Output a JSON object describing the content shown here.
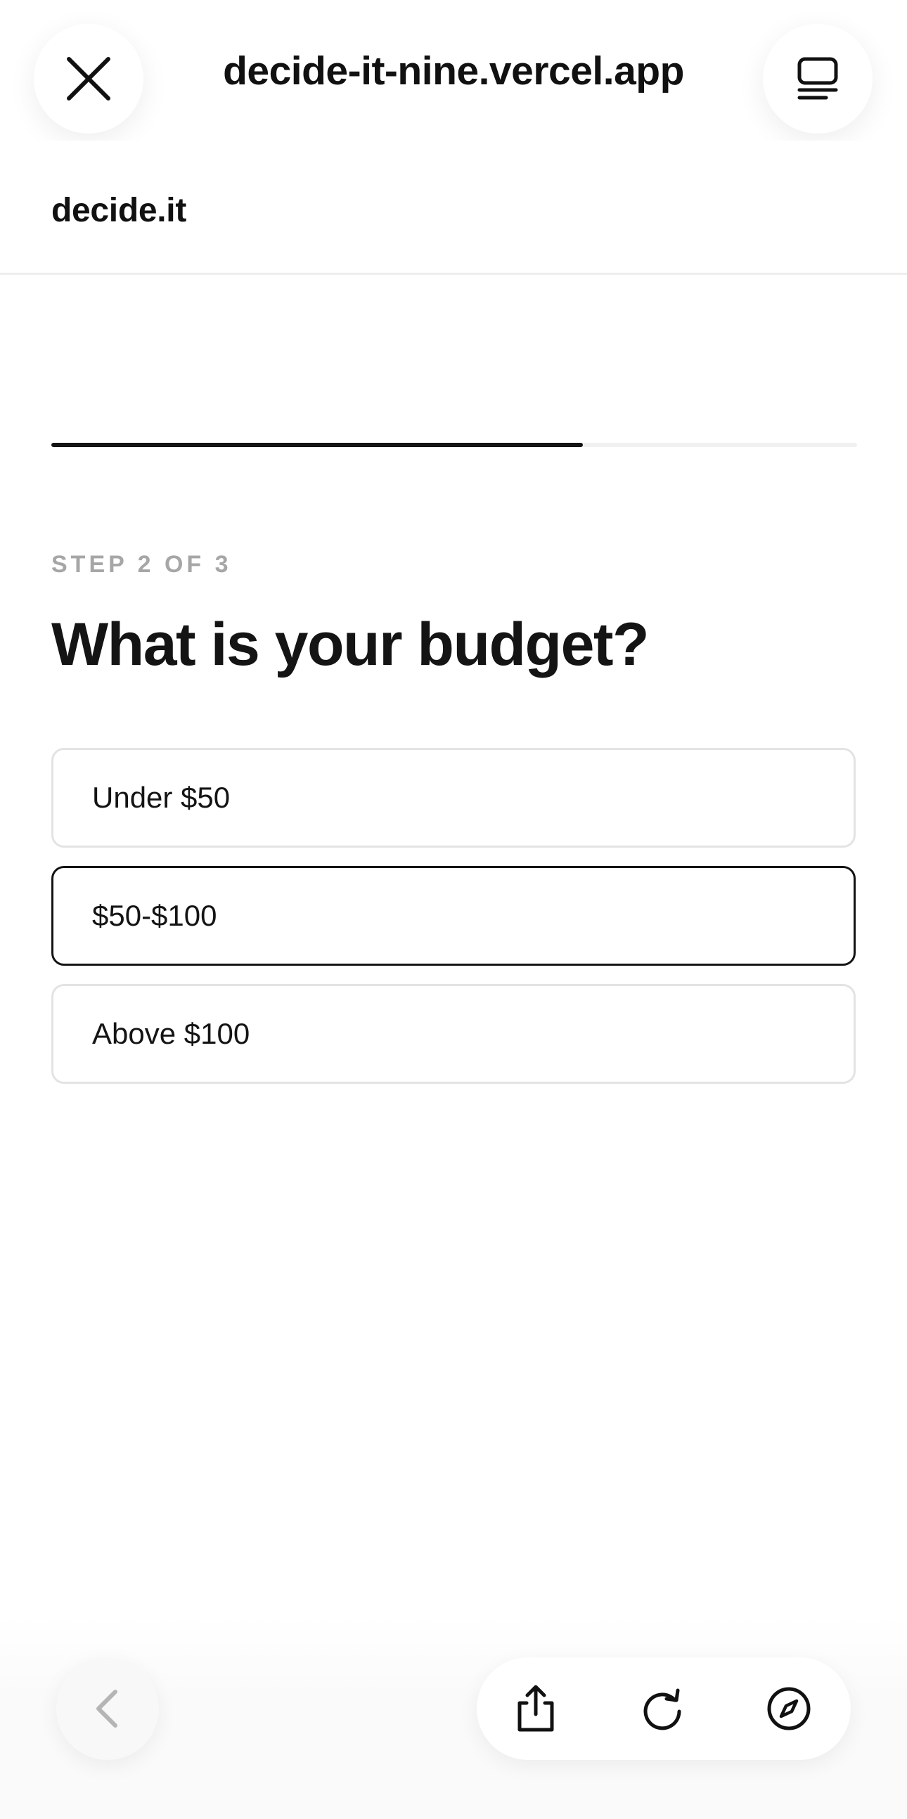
{
  "browser": {
    "url": "decide-it-nine.vercel.app",
    "close_icon": "close-icon",
    "tabs_icon": "tabs-icon",
    "back_icon": "chevron-left-icon",
    "share_icon": "share-icon",
    "reload_icon": "reload-icon",
    "compass_icon": "compass-icon"
  },
  "site": {
    "logo": "decide.it"
  },
  "progress": {
    "fraction": 0.66,
    "color": "#141414",
    "track_color": "#f1f1f1"
  },
  "step": {
    "label": "STEP 2 OF 3",
    "question": "What is your budget?"
  },
  "options": [
    {
      "label": "Under $50",
      "selected": false
    },
    {
      "label": "$50-$100",
      "selected": true
    },
    {
      "label": "Above $100",
      "selected": false
    }
  ]
}
